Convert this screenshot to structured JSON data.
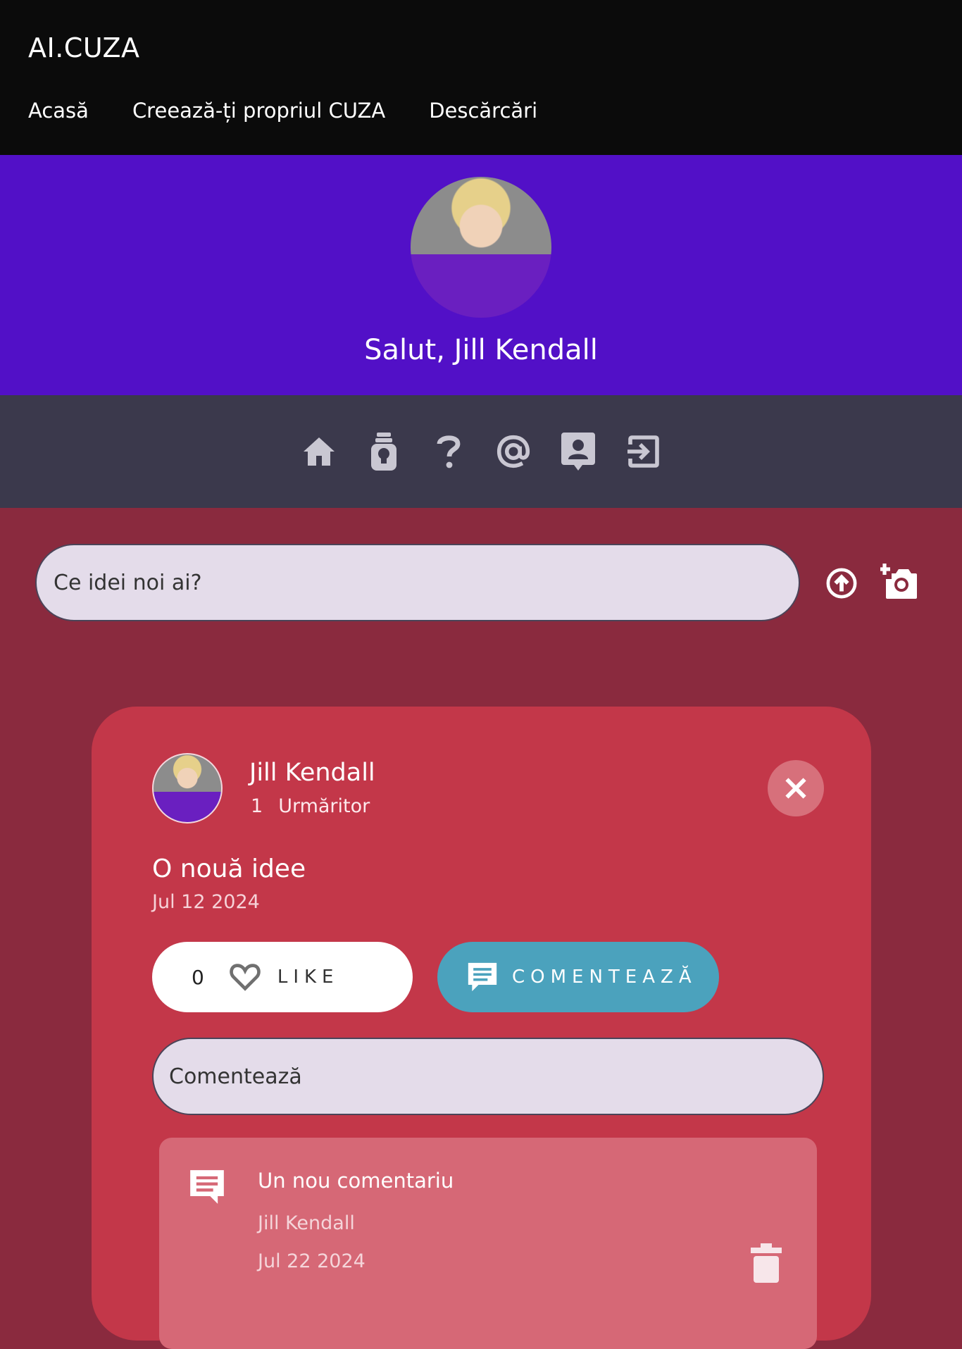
{
  "header": {
    "brand": "AI.CUZA",
    "nav": [
      "Acasă",
      "Creează-ți propriul CUZA",
      "Descărcări"
    ]
  },
  "hero": {
    "greeting": "Salut, Jill Kendall"
  },
  "iconbar": {
    "icons": [
      "home-icon",
      "lightbulb-icon",
      "help-icon",
      "at-sign-icon",
      "contact-icon",
      "logout-icon"
    ]
  },
  "composer": {
    "placeholder": "Ce idei noi ai?"
  },
  "post": {
    "author": "Jill Kendall",
    "followers_count": "1",
    "followers_label": "Urmăritor",
    "title": "O nouă idee",
    "date": "Jul 12 2024",
    "likes": "0",
    "like_label": "LIKE",
    "comment_label": "COMENTEAZĂ",
    "comment_placeholder": "Comentează",
    "comments": [
      {
        "text": "Un nou comentariu",
        "author": "Jill Kendall",
        "date": "Jul 22 2024"
      }
    ]
  },
  "colors": {
    "topbar": "#0b0b0b",
    "hero": "#5210c7",
    "iconbar": "#3b394c",
    "page": "#8a2a3e",
    "card": "#c33749",
    "comment_button": "#4ba2bd"
  }
}
